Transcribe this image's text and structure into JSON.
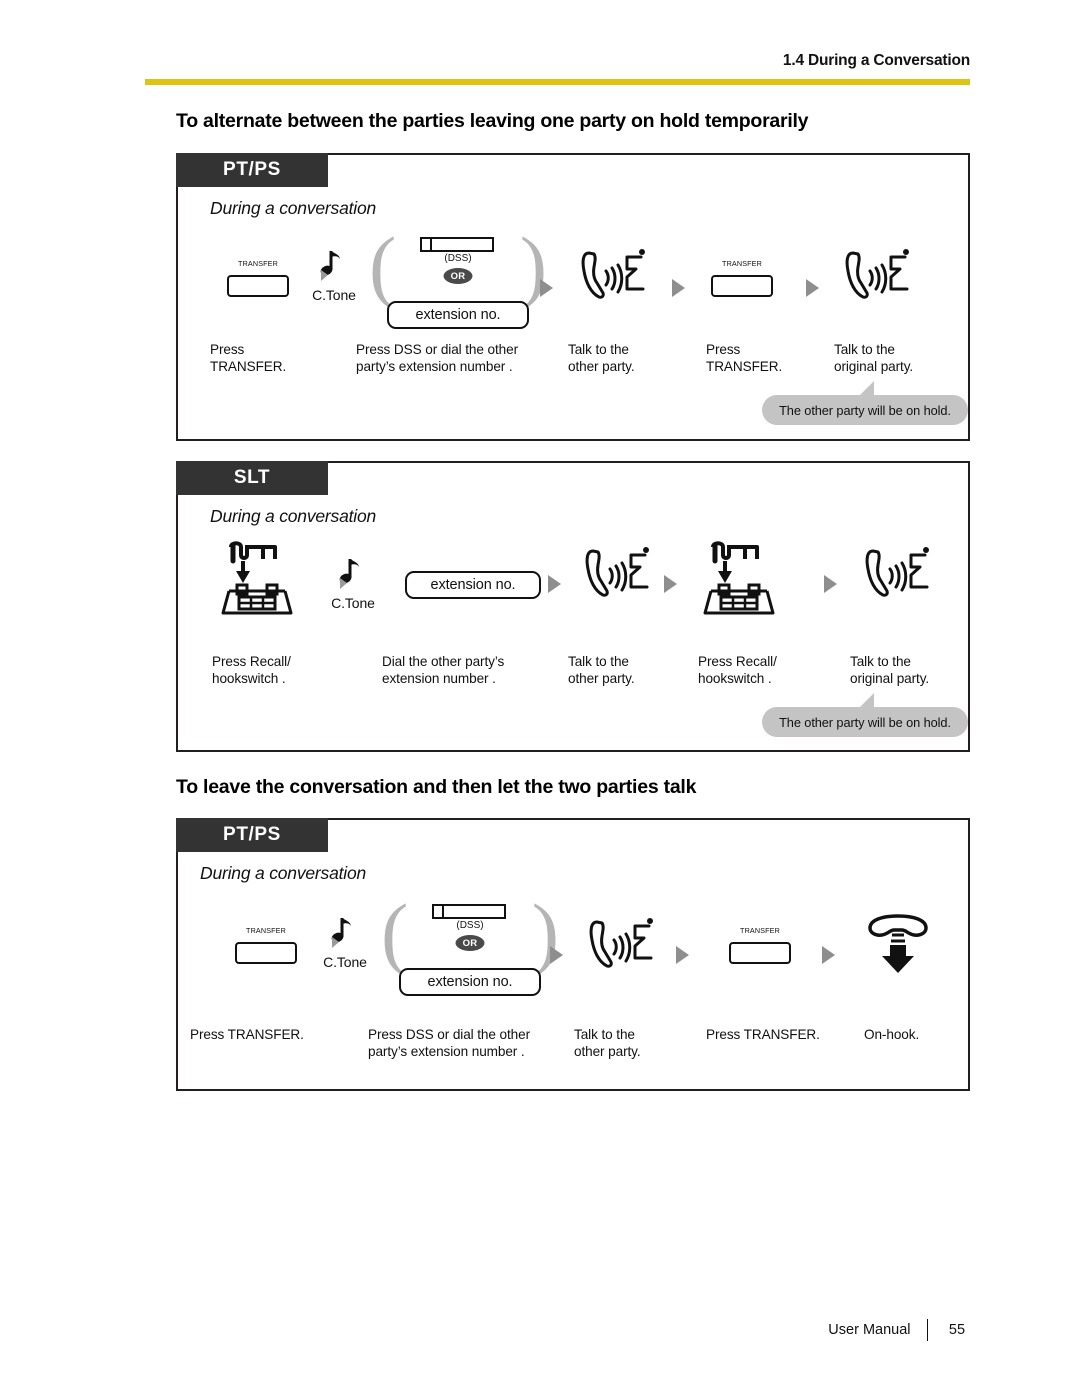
{
  "header": {
    "section_title": "1.4 During a Conversation",
    "rule_color": "#dcc410"
  },
  "footer": {
    "manual_label": "User Manual",
    "page_number": "55"
  },
  "sections": [
    {
      "heading": "To alternate between the parties leaving one party on hold temporarily",
      "diagrams": [
        {
          "phone_type": "PT/PS",
          "state_label": "During a conversation",
          "steps": [
            {
              "icon": "transfer-key-icon",
              "key_label": "TRANSFER",
              "caption": "Press\nTRANSFER."
            },
            {
              "icon": "confirmation-tone-icon",
              "tone_label": "C.Tone",
              "caption": ""
            },
            {
              "icon": "dss-or-extension-icon",
              "dss_label": "(DSS)",
              "or_label": "OR",
              "extension_label": "extension no.",
              "caption": "Press DSS or dial the other\nparty’s extension number   ."
            },
            {
              "icon": "talk-handset-icon",
              "caption": "Talk to the\nother party."
            },
            {
              "icon": "transfer-key-icon",
              "key_label": "TRANSFER",
              "caption": "Press\nTRANSFER."
            },
            {
              "icon": "talk-handset-icon",
              "caption": "Talk to the\noriginal party."
            }
          ],
          "callout": "The other party will be on hold."
        },
        {
          "phone_type": "SLT",
          "state_label": "During a conversation",
          "steps": [
            {
              "icon": "hookswitch-icon",
              "caption": "Press Recall/\nhookswitch  ."
            },
            {
              "icon": "confirmation-tone-icon",
              "tone_label": "C.Tone",
              "caption": ""
            },
            {
              "icon": "extension-no-icon",
              "extension_label": "extension no.",
              "caption": "Dial the other party’s\nextension number   ."
            },
            {
              "icon": "talk-handset-icon",
              "caption": "Talk to the\nother party."
            },
            {
              "icon": "hookswitch-icon",
              "caption": "Press Recall/\nhookswitch  ."
            },
            {
              "icon": "talk-handset-icon",
              "caption": "Talk to the\noriginal party."
            }
          ],
          "callout": "The other party will be on hold."
        }
      ]
    },
    {
      "heading": "To leave the conversation and then let the two parties talk",
      "diagrams": [
        {
          "phone_type": "PT/PS",
          "state_label": "During a conversation",
          "steps": [
            {
              "icon": "transfer-key-icon",
              "key_label": "TRANSFER",
              "caption": "Press TRANSFER."
            },
            {
              "icon": "confirmation-tone-icon",
              "tone_label": "C.Tone",
              "caption": ""
            },
            {
              "icon": "dss-or-extension-icon",
              "dss_label": "(DSS)",
              "or_label": "OR",
              "extension_label": "extension no.",
              "caption": "Press DSS or dial the other\nparty’s extension number   ."
            },
            {
              "icon": "talk-handset-icon",
              "caption": "Talk to the\nother party."
            },
            {
              "icon": "transfer-key-icon",
              "key_label": "TRANSFER",
              "caption": "Press TRANSFER."
            },
            {
              "icon": "on-hook-icon",
              "caption": "On-hook."
            }
          ],
          "callout": null
        }
      ]
    }
  ]
}
